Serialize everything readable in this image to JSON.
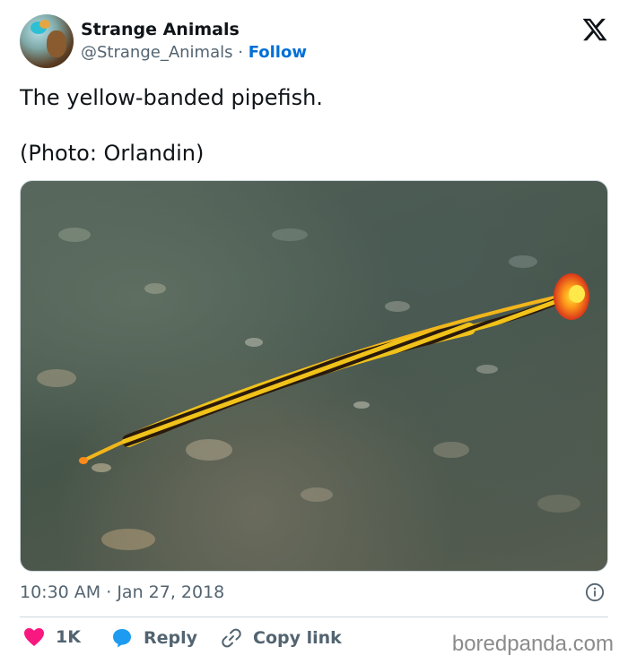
{
  "author": {
    "name": "Strange Animals",
    "handle": "@Strange_Animals",
    "separator": "·",
    "follow_label": "Follow"
  },
  "tweet": {
    "text": "The yellow-banded pipefish.\n\n(Photo: Orlandin)",
    "time": "10:30 AM",
    "separator": "·",
    "date": "Jan 27, 2018"
  },
  "actions": {
    "like_count": "1K",
    "reply_label": "Reply",
    "copy_label": "Copy link"
  },
  "watermark": "boredpanda.com",
  "icons": {
    "logo": "x-logo-icon",
    "info": "info-icon",
    "like": "heart-icon",
    "reply": "reply-bubble-icon",
    "copy": "link-icon"
  },
  "colors": {
    "follow": "#006fd6",
    "like": "#f91880",
    "reply": "#1d9bf0",
    "text_secondary": "#536471"
  }
}
